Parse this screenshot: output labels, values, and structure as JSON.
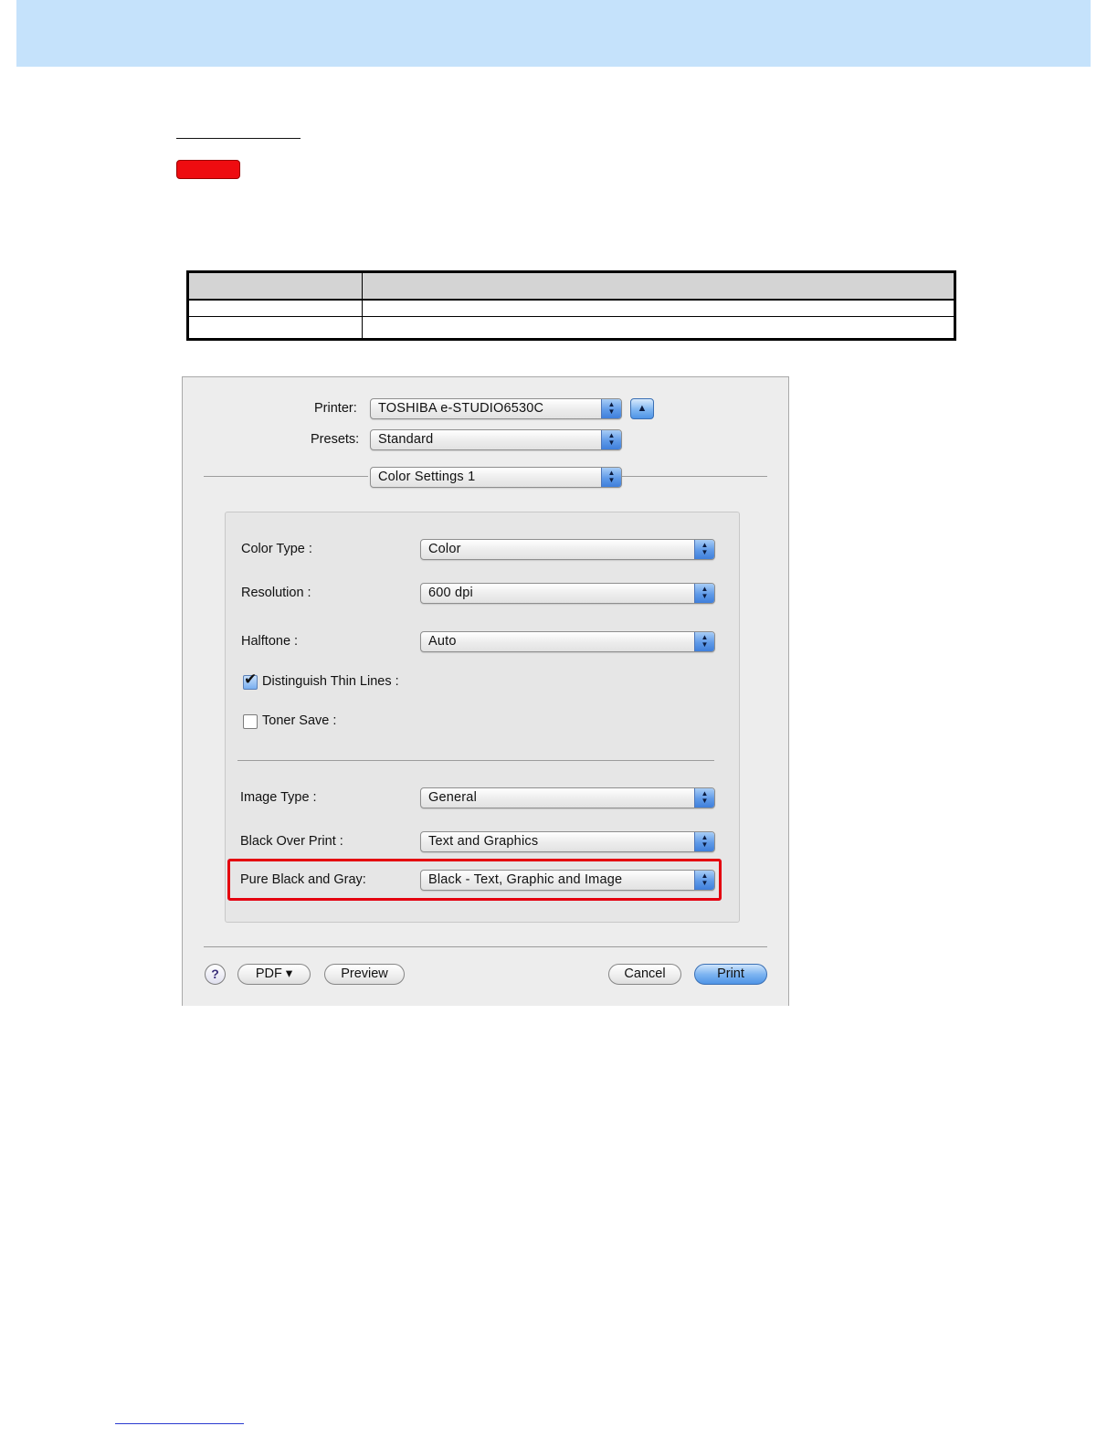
{
  "dialog": {
    "printer_label": "Printer:",
    "printer_value": "TOSHIBA e-STUDIO6530C",
    "presets_label": "Presets:",
    "presets_value": "Standard",
    "panel_value": "Color Settings 1",
    "fields": {
      "color_type_label": "Color Type :",
      "color_type_value": "Color",
      "resolution_label": "Resolution :",
      "resolution_value": "600 dpi",
      "halftone_label": "Halftone :",
      "halftone_value": "Auto",
      "thin_lines_label": "Distinguish Thin Lines :",
      "thin_lines_checked": true,
      "toner_save_label": "Toner Save :",
      "toner_save_checked": false,
      "image_type_label": "Image Type :",
      "image_type_value": "General",
      "black_over_print_label": "Black Over Print :",
      "black_over_print_value": "Text and Graphics",
      "pure_black_label": "Pure Black and Gray:",
      "pure_black_value": "Black - Text, Graphic and Image"
    },
    "buttons": {
      "help": "?",
      "pdf": "PDF ▾",
      "preview": "Preview",
      "cancel": "Cancel",
      "print": "Print"
    }
  },
  "colors": {
    "header_band": "#c5e2fb",
    "highlight_border": "#e4000f",
    "red_tag": "#ee0c10",
    "default_button": "#5f9ae8"
  }
}
